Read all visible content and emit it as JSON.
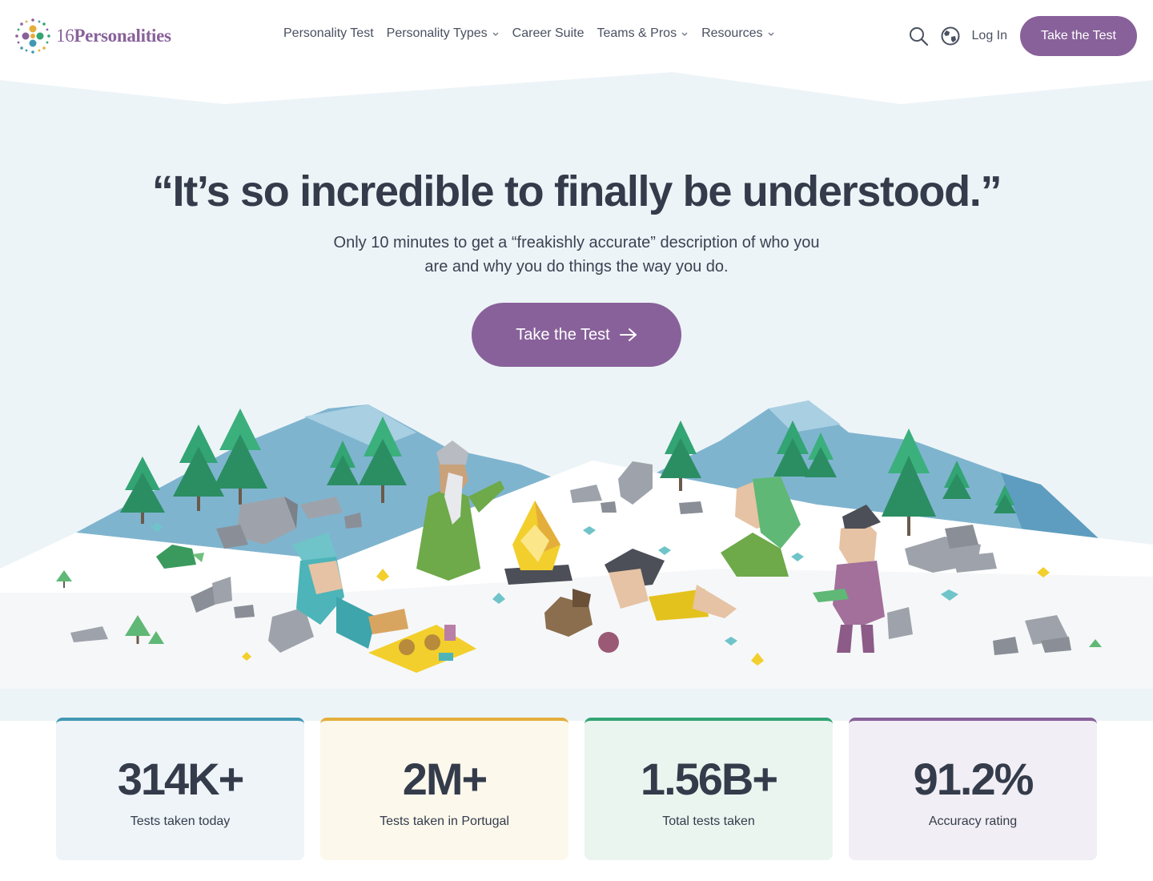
{
  "brand": {
    "logo_number": "16",
    "logo_word": "Personalities"
  },
  "nav": {
    "items": [
      {
        "label": "Personality Test",
        "dropdown": false
      },
      {
        "label": "Personality Types",
        "dropdown": true
      },
      {
        "label": "Career Suite",
        "dropdown": false
      },
      {
        "label": "Teams & Pros",
        "dropdown": true
      },
      {
        "label": "Resources",
        "dropdown": true
      }
    ],
    "search_icon": "search-icon",
    "language_icon": "globe-icon",
    "login_label": "Log In",
    "cta_label": "Take the Test"
  },
  "hero": {
    "title": "“It’s so incredible to finally be understood.”",
    "subtitle": "Only 10 minutes to get a “freakishly accurate” description of who you are and why you do things the way you do.",
    "cta_label": "Take the Test",
    "cta_icon": "arrow-right-icon"
  },
  "stats": [
    {
      "value": "314K+",
      "label": "Tests taken today",
      "accent": "#4298b4",
      "bg": "#eef4f8"
    },
    {
      "value": "2M+",
      "label": "Tests taken in Portugal",
      "accent": "#e4ae3a",
      "bg": "#fcf8ec"
    },
    {
      "value": "1.56B+",
      "label": "Total tests taken",
      "accent": "#33a474",
      "bg": "#ebf5f0"
    },
    {
      "value": "91.2%",
      "label": "Accuracy rating",
      "accent": "#88619a",
      "bg": "#f1eef5"
    }
  ],
  "colors": {
    "brand_purple": "#88619a",
    "hero_background": "#edf4f7",
    "text_dark": "#343c4b"
  }
}
